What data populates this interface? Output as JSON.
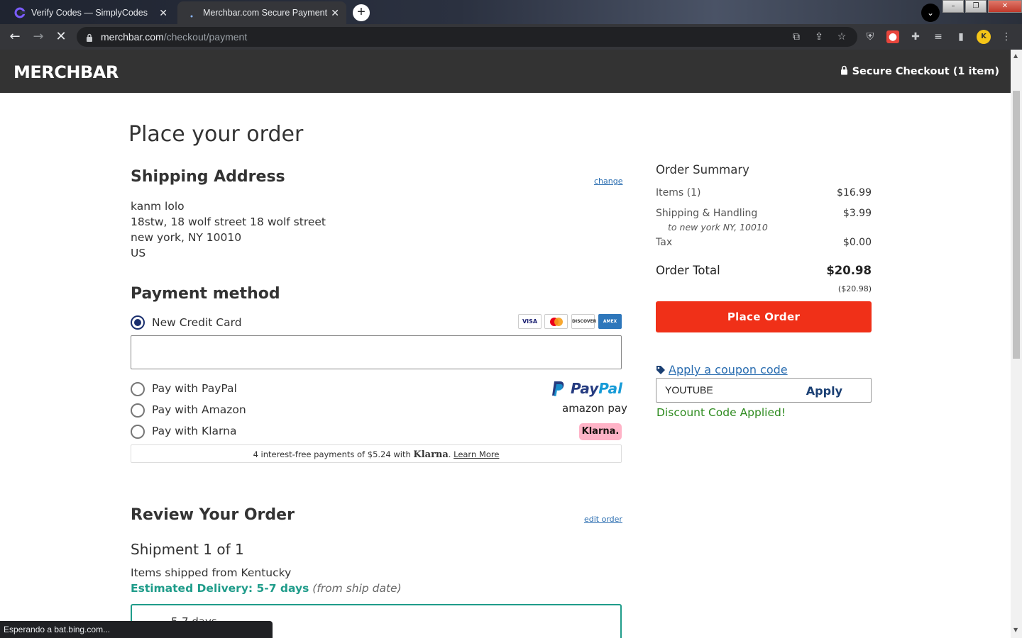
{
  "browser": {
    "tabs": [
      {
        "title": "Verify Codes — SimplyCodes",
        "active": false
      },
      {
        "title": "Merchbar.com Secure Payment",
        "active": true
      }
    ],
    "url_domain": "merchbar.com",
    "url_path": "/checkout/payment",
    "status_text": "Esperando a bat.bing.com..."
  },
  "header": {
    "logo": "MERCHBAR",
    "secure_checkout": "Secure Checkout (1 item)"
  },
  "page": {
    "title": "Place your order"
  },
  "shipping": {
    "heading": "Shipping Address",
    "change_link": "change",
    "lines": [
      "kanm lolo",
      "18stw, 18 wolf street 18 wolf street",
      "new york, NY 10010",
      "US"
    ]
  },
  "payment": {
    "heading": "Payment method",
    "options": [
      {
        "label": "New Credit Card",
        "selected": true
      },
      {
        "label": "Pay with PayPal",
        "selected": false
      },
      {
        "label": "Pay with Amazon",
        "selected": false
      },
      {
        "label": "Pay with Klarna",
        "selected": false
      }
    ],
    "card_brands": [
      "VISA",
      "MC",
      "DISCOVER",
      "AMEX"
    ],
    "paypal_logo": [
      "Pay",
      "Pal"
    ],
    "amazon_logo": "amazon pay",
    "klarna_badge": "Klarna.",
    "klarna_note_pre": "4 interest-free payments of $5.24 with ",
    "klarna_note_brand": "Klarna",
    "klarna_note_sep": ". ",
    "klarna_learn_more": "Learn More"
  },
  "review": {
    "heading": "Review Your Order",
    "edit_link": "edit order",
    "shipment_label": "Shipment 1 of 1",
    "shipped_from": "Items shipped from Kentucky",
    "eta_label": "Estimated Delivery: 5-7 days",
    "eta_note": "(from ship date)",
    "option_label": "5-7 days"
  },
  "summary": {
    "title": "Order Summary",
    "items_label": "Items (1)",
    "items_value": "$16.99",
    "shipping_label": "Shipping & Handling",
    "shipping_value": "$3.99",
    "shipping_to": "to new york NY, 10010",
    "tax_label": "Tax",
    "tax_value": "$0.00",
    "total_label": "Order Total",
    "total_value": "$20.98",
    "total_sub": "($20.98)",
    "place_order": "Place Order",
    "coupon_link": "Apply a coupon code",
    "coupon_value": "YOUTUBE",
    "apply_label": "Apply",
    "discount_msg": "Discount Code Applied!"
  },
  "colors": {
    "accent_red": "#f03018",
    "header_bg": "#333333",
    "link_blue": "#2a6db0",
    "teal": "#1f9c8a",
    "success_green": "#2e8b1f"
  }
}
